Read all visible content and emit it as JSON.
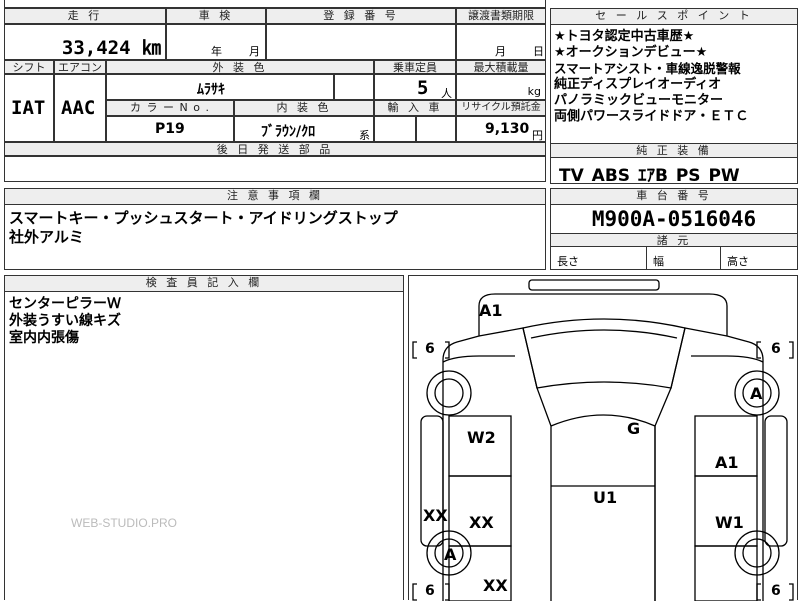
{
  "top_left": {
    "mileage_label": "走 行",
    "mileage_value": "33,424 ㎞",
    "inspection_label": "車 検",
    "inspection_year_unit": "年",
    "inspection_month_unit": "月",
    "registration_label": "登 録 番 号",
    "transfer_deadline_label": "譲渡書類期限",
    "transfer_month_unit": "月",
    "transfer_day_unit": "日",
    "shift_label": "シフト",
    "shift_value": "IAT",
    "aircon_label": "エアコン",
    "aircon_value": "AAC",
    "exterior_color_label": "外 装 色",
    "exterior_color_value": "ﾑﾗｻｷ",
    "capacity_label": "乗車定員",
    "capacity_value": "5",
    "capacity_unit": "人",
    "max_load_label": "最大積載量",
    "max_load_unit": "kg",
    "color_no_label": "カ ラ ー N o .",
    "color_no_value": "P19",
    "interior_color_label": "内 装 色",
    "interior_color_value": "ﾌﾞﾗｳﾝ/ｸﾛ",
    "interior_suffix": "系",
    "import_label": "輸 入 車",
    "recycle_label": "リサイクル預託金",
    "recycle_value": "9,130",
    "recycle_unit": "円",
    "later_parts_label": "後 日 発 送 部 品"
  },
  "sales_points": {
    "header": "セ ー ル ス ポ イ ン ト",
    "lines": [
      "★トヨタ認定中古車歴★",
      "★オークションデビュー★",
      "スマートアシスト・車線逸脱警報",
      "純正ディスプレイオーディオ",
      "パノラミックビューモニター",
      "両側パワースライドドア・ＥＴＣ"
    ]
  },
  "standard_equipment": {
    "header": "純 正 装 備",
    "value": "TV ABS ｴｱB PS PW"
  },
  "notes": {
    "header": "注 意 事 項 欄",
    "lines": [
      "スマートキー・プッシュスタート・アイドリングストップ",
      "社外アルミ"
    ]
  },
  "chassis": {
    "header": "車 台 番 号",
    "value": "M900A-0516046",
    "specs_header": "諸 元",
    "length_label": "長さ",
    "width_label": "幅",
    "height_label": "高さ"
  },
  "inspector": {
    "header": "検 査 員 記 入 欄",
    "lines": [
      "センターピラーＷ",
      "外装うすい線キズ",
      "室内内張傷"
    ]
  },
  "watermark": "WEB-STUDIO.PRO",
  "diagram_marks": {
    "top": "A1",
    "tire_fl_label": "6",
    "tire_fr_label": "6",
    "tire_rl_label": "6",
    "tire_rr_label": "6",
    "left_front": "W2",
    "left_rocker": "XX",
    "left_rear_door": "XX",
    "left_wheel": "A",
    "left_rear_bottom": "XX",
    "center_glass": "G",
    "roof": "U1",
    "right_wheel": "A",
    "right_front_door": "A1",
    "right_rear_door": "W1"
  }
}
